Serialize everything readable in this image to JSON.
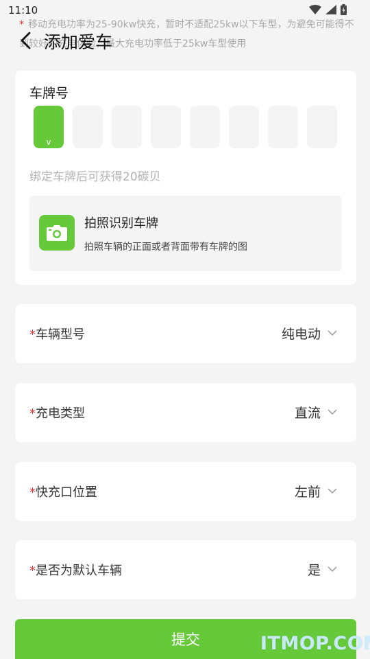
{
  "status_bar": {
    "time": "11:10",
    "icons": [
      "wifi-icon",
      "signal-icon",
      "battery-icon"
    ]
  },
  "notice": {
    "star": "*",
    "text": "移动充电功率为25-90kw快充，暂时不适配25kw以下车型，为避免可能得不到较好的充电体验，最大充电功率低于25kw车型使用"
  },
  "nav": {
    "title": "添加爱车"
  },
  "plate": {
    "label": "车牌号",
    "cells": [
      "",
      "",
      "",
      "",
      "",
      "",
      "",
      ""
    ],
    "active_caret": "v",
    "hint": "绑定车牌后可获得20碳贝",
    "photo_title": "拍照识别车牌",
    "photo_subtitle": "拍照车辆的正面或者背面带有车牌的图"
  },
  "form": {
    "required_mark": "*",
    "rows": [
      {
        "label": "车辆型号",
        "value": "纯电动"
      },
      {
        "label": "充电类型",
        "value": "直流"
      },
      {
        "label": "快充口位置",
        "value": "左前"
      },
      {
        "label": "是否为默认车辆",
        "value": "是"
      }
    ]
  },
  "submit_label": "提交",
  "watermark": "ITMOP.COM",
  "colors": {
    "accent": "#65c93a",
    "required": "#e03333",
    "background": "#f4f4f4"
  }
}
